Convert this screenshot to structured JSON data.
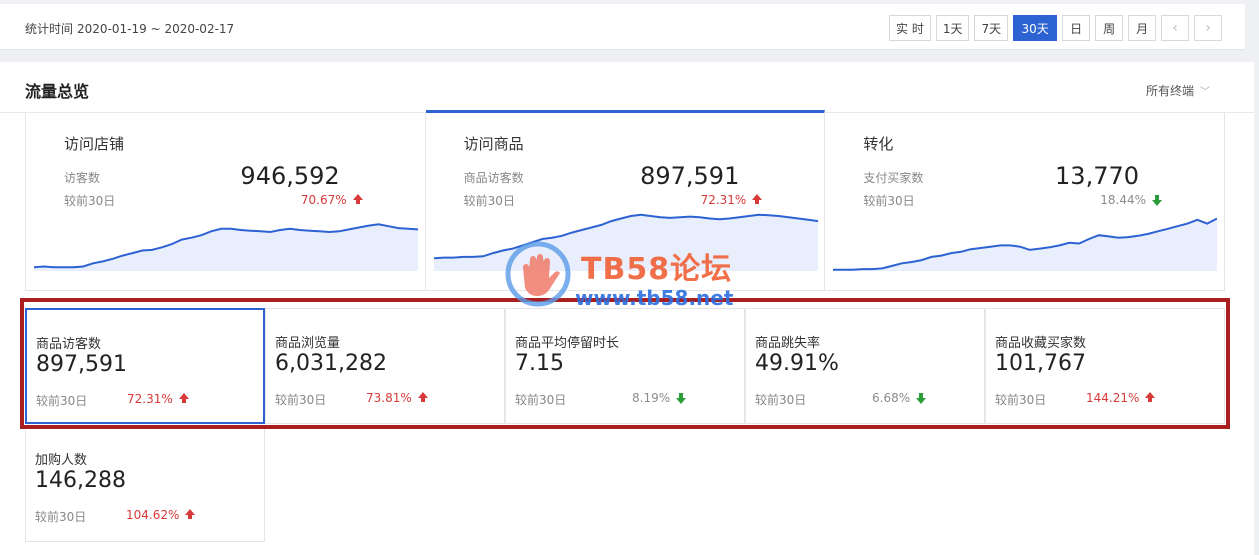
{
  "topbar": {
    "period_label": "统计时间",
    "period_range": "2020-01-19 ~ 2020-02-17",
    "buttons": [
      "实 时",
      "1天",
      "7天",
      "30天",
      "日",
      "周",
      "月"
    ],
    "active_button": "30天"
  },
  "panel": {
    "title": "流量总览",
    "terminal_select": "所有终端"
  },
  "cards": [
    {
      "title": "访问店铺",
      "sub": "访客数",
      "compare": "较前30日",
      "value": "946,592",
      "change": "70.67%",
      "direction": "up",
      "series": [
        0.06,
        0.07,
        0.06,
        0.06,
        0.06,
        0.07,
        0.12,
        0.15,
        0.19,
        0.24,
        0.28,
        0.32,
        0.33,
        0.37,
        0.42,
        0.49,
        0.52,
        0.56,
        0.62,
        0.66,
        0.66,
        0.64,
        0.63,
        0.62,
        0.61,
        0.64,
        0.66,
        0.64,
        0.63,
        0.62,
        0.61,
        0.62,
        0.65,
        0.68,
        0.71,
        0.73,
        0.7,
        0.67,
        0.66,
        0.65
      ]
    },
    {
      "title": "访问商品",
      "sub": "商品访客数",
      "compare": "较前30日",
      "value": "897,591",
      "change": "72.31%",
      "direction": "up",
      "series": [
        0.2,
        0.21,
        0.21,
        0.22,
        0.22,
        0.23,
        0.28,
        0.32,
        0.35,
        0.4,
        0.45,
        0.5,
        0.52,
        0.55,
        0.6,
        0.64,
        0.68,
        0.72,
        0.78,
        0.82,
        0.86,
        0.88,
        0.86,
        0.84,
        0.83,
        0.84,
        0.85,
        0.84,
        0.82,
        0.81,
        0.82,
        0.84,
        0.86,
        0.88,
        0.87,
        0.86,
        0.84,
        0.82,
        0.8,
        0.78
      ]
    },
    {
      "title": "转化",
      "sub": "支付买家数",
      "compare": "较前30日",
      "value": "13,770",
      "change": "18.44%",
      "direction": "down",
      "series": [
        0.02,
        0.02,
        0.02,
        0.03,
        0.03,
        0.04,
        0.08,
        0.12,
        0.14,
        0.17,
        0.22,
        0.24,
        0.28,
        0.3,
        0.34,
        0.36,
        0.38,
        0.4,
        0.4,
        0.38,
        0.33,
        0.35,
        0.37,
        0.4,
        0.44,
        0.43,
        0.5,
        0.56,
        0.54,
        0.52,
        0.53,
        0.55,
        0.58,
        0.62,
        0.66,
        0.7,
        0.74,
        0.8,
        0.74,
        0.82
      ]
    }
  ],
  "metrics": [
    {
      "label": "商品访客数",
      "value": "897,591",
      "compare": "较前30日",
      "change": "72.31%",
      "direction": "up"
    },
    {
      "label": "商品浏览量",
      "value": "6,031,282",
      "compare": "较前30日",
      "change": "73.81%",
      "direction": "up"
    },
    {
      "label": "商品平均停留时长",
      "value": "7.15",
      "compare": "较前30日",
      "change": "8.19%",
      "direction": "down"
    },
    {
      "label": "商品跳失率",
      "value": "49.91%",
      "compare": "较前30日",
      "change": "6.68%",
      "direction": "down"
    },
    {
      "label": "商品收藏买家数",
      "value": "101,767",
      "compare": "较前30日",
      "change": "144.21%",
      "direction": "up"
    },
    {
      "label": "加购人数",
      "value": "146,288",
      "compare": "较前30日",
      "change": "104.62%",
      "direction": "up"
    }
  ],
  "watermark": {
    "brand": "TB58论坛",
    "url": "www.tb58.net"
  },
  "colors": {
    "accent": "#2d62d3",
    "up": "#d83a3a",
    "down_arrow": "#2a9d3a",
    "highlight_box": "#a91f1f",
    "sparkline_fill": "#e8eefb"
  }
}
